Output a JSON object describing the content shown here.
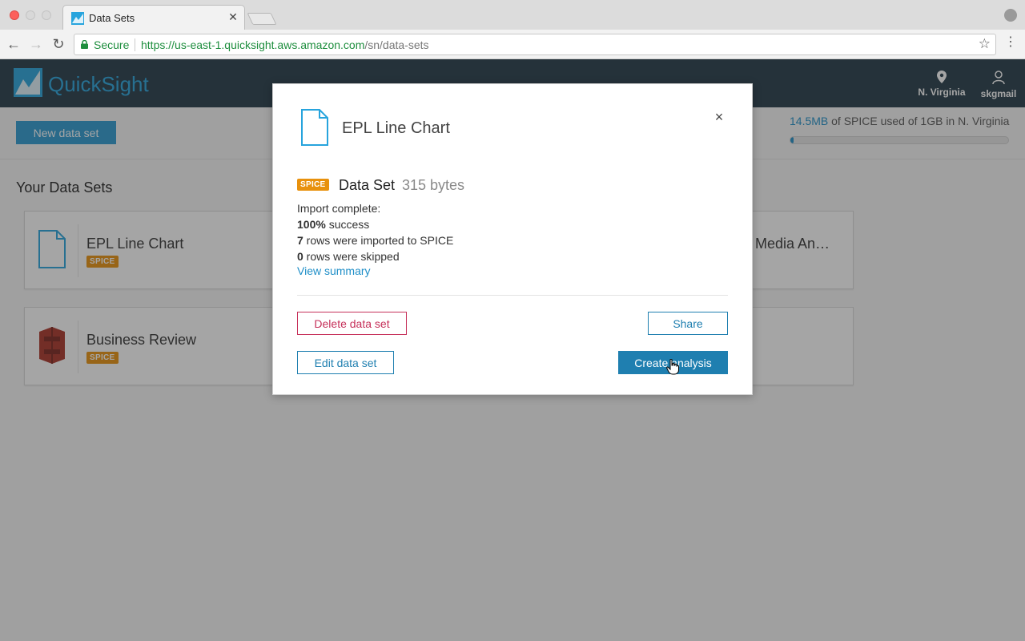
{
  "browser": {
    "tab_title": "Data Sets",
    "tab_close": "✕",
    "secure_label": "Secure",
    "url_scheme": "https://",
    "url_host": "us-east-1.quicksight.aws.amazon.com",
    "url_path": "/sn/data-sets"
  },
  "app": {
    "brand": "QuickSight",
    "region_label": "N. Virginia",
    "user_label": "skgmail"
  },
  "toolbar": {
    "new_data_set": "New data set"
  },
  "spice_usage": {
    "used": "14.5MB",
    "suffix": " of SPICE used of 1GB in N. Virginia",
    "fraction": 0.014
  },
  "datasets": {
    "section_title": "Your Data Sets",
    "cards": [
      {
        "name": "EPL Line Chart",
        "badge": "SPICE",
        "icon": "document-icon"
      },
      {
        "name": "Business Review",
        "badge": "SPICE",
        "icon": "s3-bucket-icon"
      },
      {
        "name": "Media An…"
      }
    ]
  },
  "modal": {
    "title": "EPL Line Chart",
    "close": "×",
    "badge": "SPICE",
    "type_label": "Data Set",
    "size": "315 bytes",
    "import_status": "Import complete:",
    "success_value": "100%",
    "success_text": " success",
    "imported_value": "7",
    "imported_text": " rows were imported to SPICE",
    "skipped_value": "0",
    "skipped_text": " rows were skipped",
    "view_summary": "View summary",
    "delete_label": "Delete data set",
    "share_label": "Share",
    "edit_label": "Edit data set",
    "create_label": "Create analysis"
  },
  "colors": {
    "header_bg": "#243a48",
    "brand_blue": "#27a4dd",
    "primary": "#1f7fb0",
    "spice_badge": "#e8910d",
    "danger": "#c6305a"
  }
}
